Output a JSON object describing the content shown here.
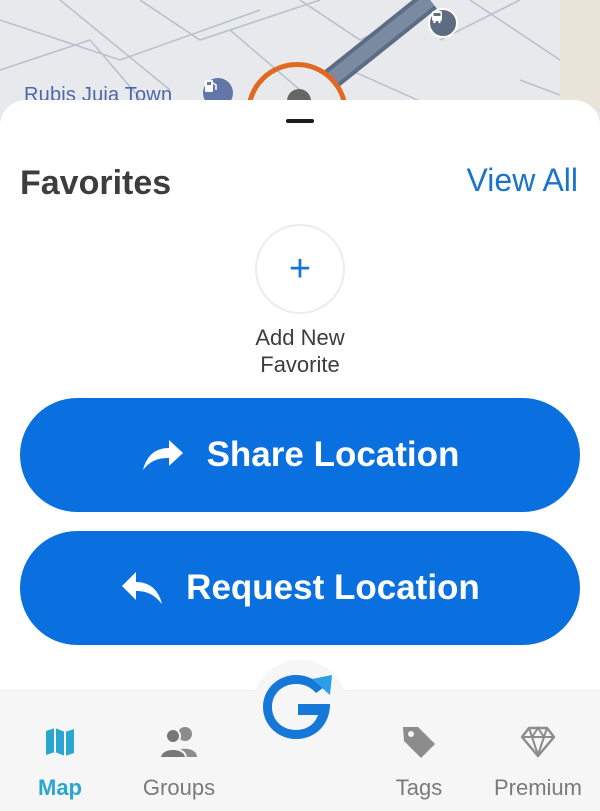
{
  "map": {
    "place_label": "Rubis Juja Town",
    "fuel_icon": "fuel-station-icon",
    "bus_icon": "bus-icon"
  },
  "favorites": {
    "title": "Favorites",
    "view_all": "View All",
    "add_new_line1": "Add New",
    "add_new_line2": "Favorite"
  },
  "actions": {
    "share": "Share Location",
    "request": "Request Location"
  },
  "nav": {
    "map": "Map",
    "groups": "Groups",
    "tags": "Tags",
    "premium": "Premium"
  },
  "colors": {
    "primary": "#0a70e0",
    "link": "#1a73cf",
    "active_tab": "#2aa6d0",
    "marker": "#e06a22"
  }
}
